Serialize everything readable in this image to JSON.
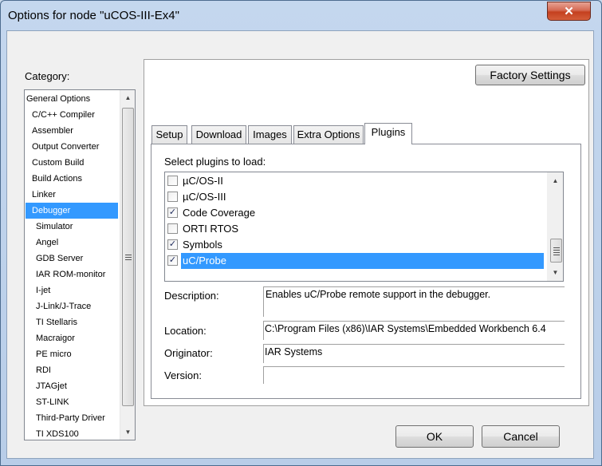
{
  "window": {
    "title": "Options for node \"uCOS-III-Ex4\"",
    "close_glyph": "✕"
  },
  "category": {
    "label": "Category:",
    "items": [
      {
        "label": "General Options",
        "indent": 0
      },
      {
        "label": "C/C++ Compiler",
        "indent": 1
      },
      {
        "label": "Assembler",
        "indent": 1
      },
      {
        "label": "Output Converter",
        "indent": 1
      },
      {
        "label": "Custom Build",
        "indent": 1
      },
      {
        "label": "Build Actions",
        "indent": 1
      },
      {
        "label": "Linker",
        "indent": 1
      },
      {
        "label": "Debugger",
        "indent": 1,
        "selected": true
      },
      {
        "label": "Simulator",
        "indent": 2
      },
      {
        "label": "Angel",
        "indent": 2
      },
      {
        "label": "GDB Server",
        "indent": 2
      },
      {
        "label": "IAR ROM-monitor",
        "indent": 2
      },
      {
        "label": "I-jet",
        "indent": 2
      },
      {
        "label": "J-Link/J-Trace",
        "indent": 2
      },
      {
        "label": "TI Stellaris",
        "indent": 2
      },
      {
        "label": "Macraigor",
        "indent": 2
      },
      {
        "label": "PE micro",
        "indent": 2
      },
      {
        "label": "RDI",
        "indent": 2
      },
      {
        "label": "JTAGjet",
        "indent": 2
      },
      {
        "label": "ST-LINK",
        "indent": 2
      },
      {
        "label": "Third-Party Driver",
        "indent": 2
      },
      {
        "label": "TI XDS100",
        "indent": 2
      }
    ]
  },
  "factory_settings_label": "Factory Settings",
  "tabs": [
    {
      "label": "Setup"
    },
    {
      "label": "Download"
    },
    {
      "label": "Images"
    },
    {
      "label": "Extra Options"
    },
    {
      "label": "Plugins",
      "active": true
    }
  ],
  "plugins": {
    "prompt": "Select plugins to load:",
    "items": [
      {
        "label": "µC/OS-II",
        "checked": false
      },
      {
        "label": "µC/OS-III",
        "checked": false
      },
      {
        "label": "Code Coverage",
        "checked": true
      },
      {
        "label": "ORTI RTOS",
        "checked": false
      },
      {
        "label": "Symbols",
        "checked": true
      },
      {
        "label": "uC/Probe",
        "checked": true,
        "selected": true
      }
    ]
  },
  "details": {
    "description_label": "Description:",
    "description_value": "Enables uC/Probe remote support in the debugger.",
    "location_label": "Location:",
    "location_value": "C:\\Program Files (x86)\\IAR Systems\\Embedded Workbench 6.4",
    "originator_label": "Originator:",
    "originator_value": "IAR Systems",
    "version_label": "Version:",
    "version_value": ""
  },
  "buttons": {
    "ok": "OK",
    "cancel": "Cancel"
  },
  "check_glyph": "✓",
  "colors": {
    "selection": "#3399ff",
    "close_button": "#c4401f"
  }
}
